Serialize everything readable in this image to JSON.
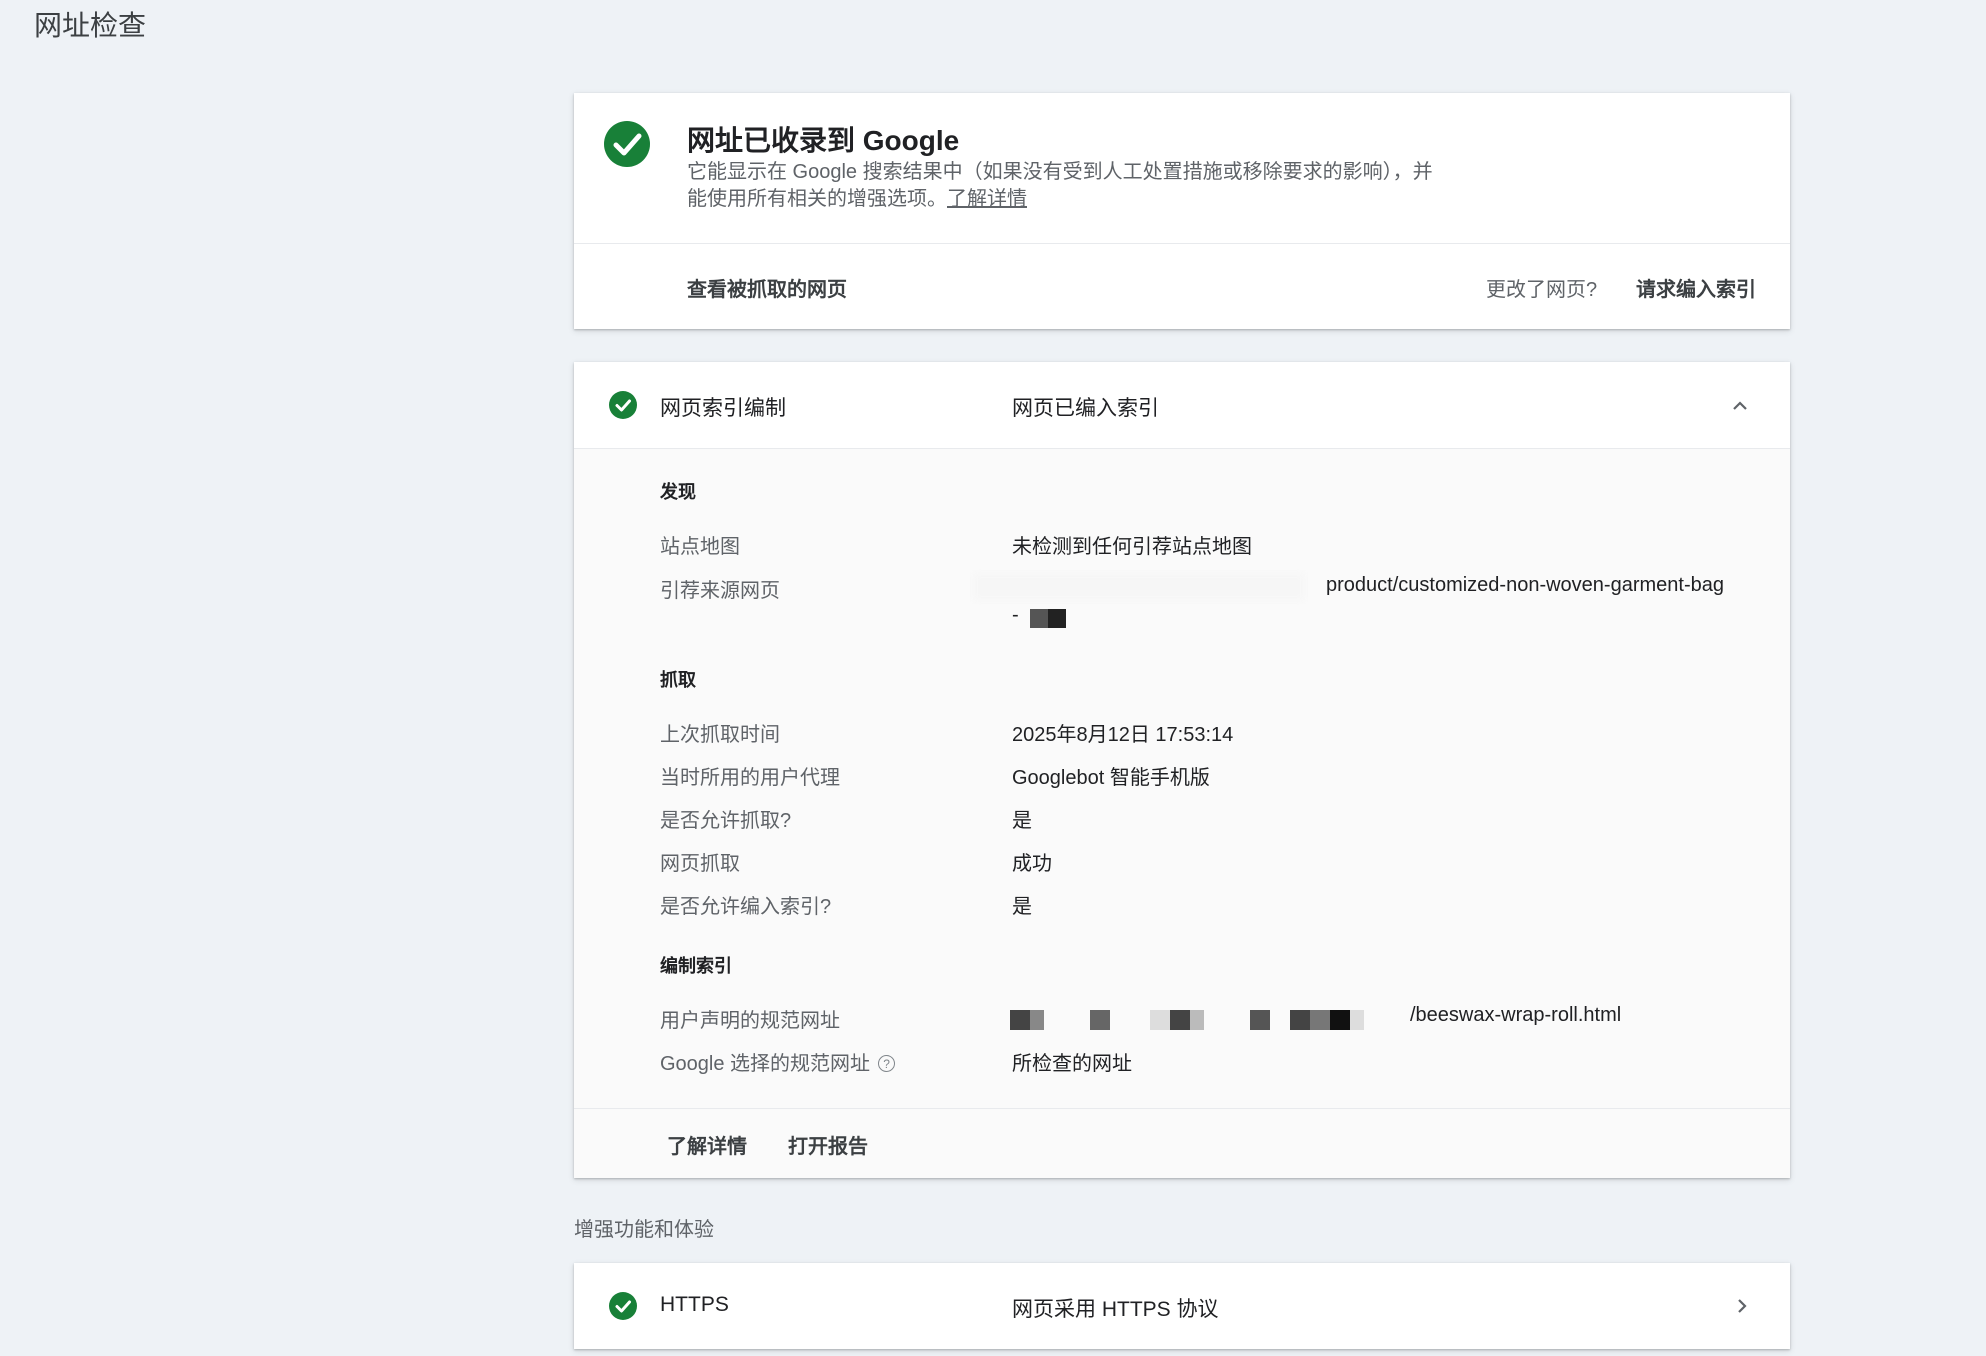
{
  "page": {
    "title": "网址检查"
  },
  "summary": {
    "title": "网址已收录到 Google",
    "description": "它能显示在 Google 搜索结果中（如果没有受到人工处置措施或移除要求的影响），并能使用所有相关的增强选项。",
    "learn_more": "了解详情",
    "view_crawled": "查看被抓取的网页",
    "changed_question": "更改了网页?",
    "request_indexing": "请求编入索引"
  },
  "indexing": {
    "label": "网页索引编制",
    "status": "网页已编入索引",
    "discovery": {
      "heading": "发现",
      "sitemap_label": "站点地图",
      "sitemap_value": "未检测到任何引荐站点地图",
      "referring_label": "引荐来源网页",
      "referring_value_line1": "product/customized-non-woven-garment-bag",
      "referring_value_line2": "-"
    },
    "crawl": {
      "heading": "抓取",
      "last_crawl_label": "上次抓取时间",
      "last_crawl_value": "2025年8月12日 17:53:14",
      "user_agent_label": "当时所用的用户代理",
      "user_agent_value": "Googlebot 智能手机版",
      "allowed_label": "是否允许抓取?",
      "allowed_value": "是",
      "fetch_label": "网页抓取",
      "fetch_value": "成功",
      "indexing_allowed_label": "是否允许编入索引?",
      "indexing_allowed_value": "是"
    },
    "canonical": {
      "heading": "编制索引",
      "user_declared_label": "用户声明的规范网址",
      "user_declared_value": "/beeswax-wrap-roll.html",
      "google_selected_label": "Google 选择的规范网址",
      "google_selected_value": "所检查的网址"
    },
    "footer": {
      "learn_more": "了解详情",
      "open_report": "打开报告"
    }
  },
  "enhancements": {
    "heading": "增强功能和体验",
    "https_label": "HTTPS",
    "https_status": "网页采用 HTTPS 协议"
  },
  "colors": {
    "success": "#188038",
    "background": "#eef2f6"
  }
}
